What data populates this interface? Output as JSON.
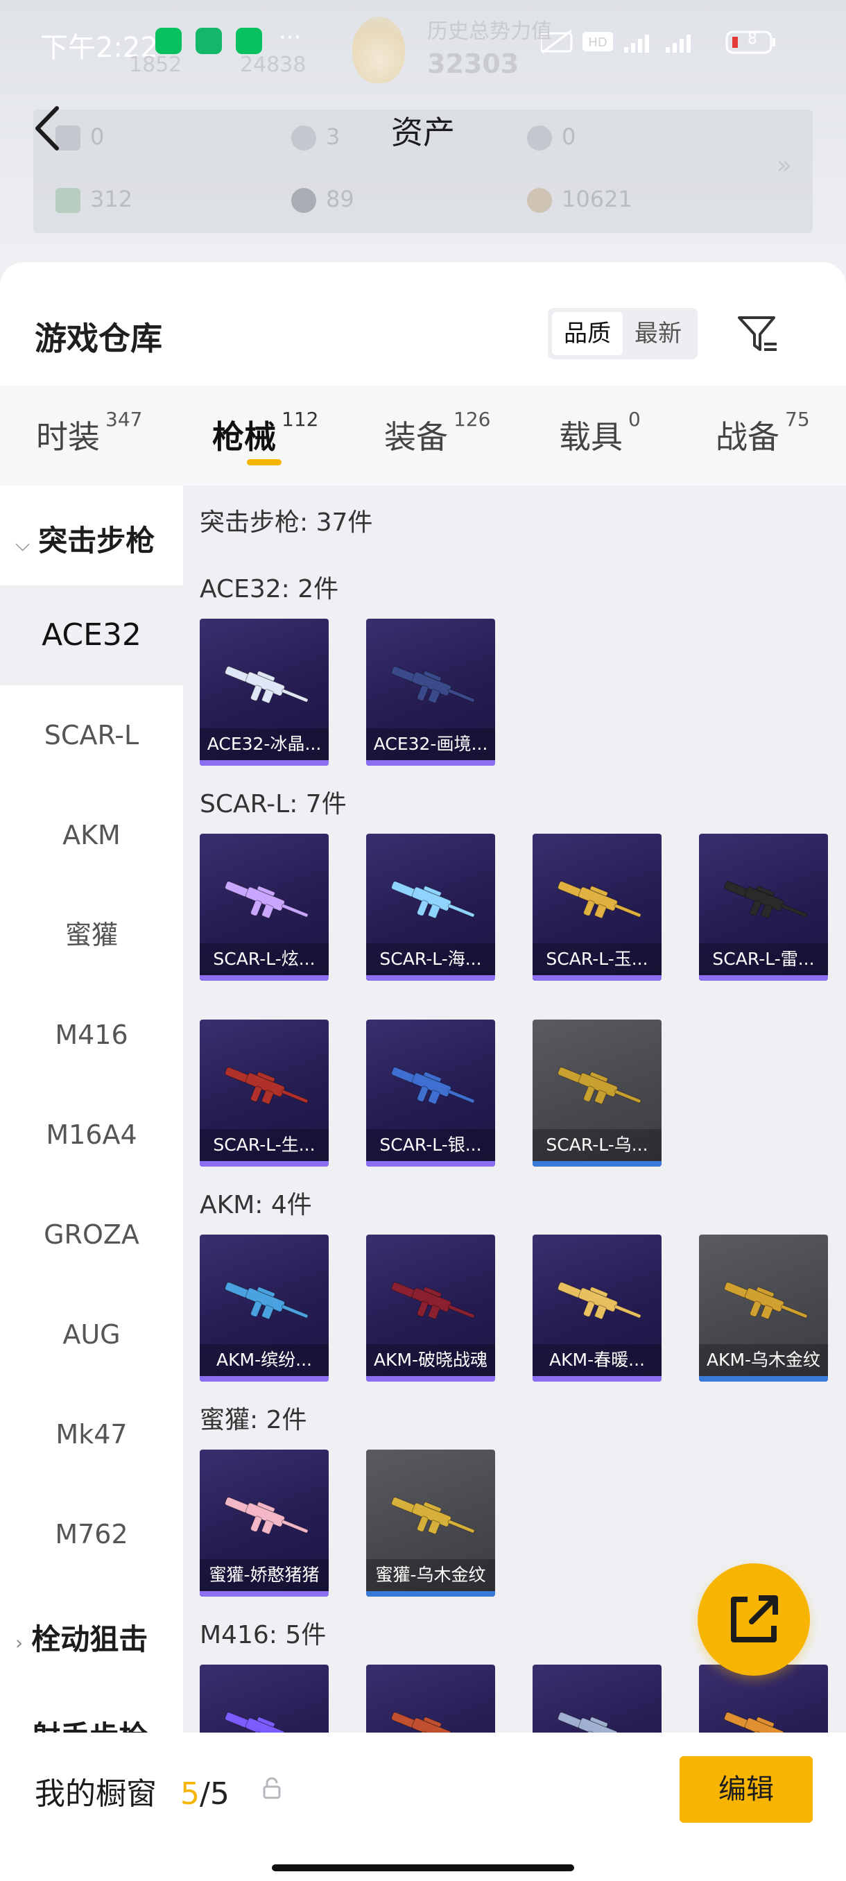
{
  "status_bar": {
    "time": "下午2:22",
    "dots": "···",
    "battery": "8"
  },
  "background_ghost": {
    "left_value": "1852",
    "middle_value": "24838",
    "history_label": "历史总势力值",
    "history_value": "32303"
  },
  "assets": {
    "title": "资产",
    "items": [
      {
        "icon": "card-icon",
        "value": "0"
      },
      {
        "icon": "coin-s-icon",
        "value": "3"
      },
      {
        "icon": "coin-a-icon",
        "value": "0"
      },
      {
        "icon": "ticket-icon",
        "value": "312"
      },
      {
        "icon": "ball-icon",
        "value": "89"
      },
      {
        "icon": "medal-icon",
        "value": "10621"
      }
    ],
    "more": "»"
  },
  "warehouse": {
    "title": "游戏仓库",
    "sort_quality": "品质",
    "sort_newest": "最新"
  },
  "tabs": [
    {
      "label": "时装",
      "count": "347"
    },
    {
      "label": "枪械",
      "count": "112"
    },
    {
      "label": "装备",
      "count": "126"
    },
    {
      "label": "载具",
      "count": "0"
    },
    {
      "label": "战备",
      "count": "75"
    }
  ],
  "sidebar": {
    "group_open": "突击步枪",
    "items": [
      "ACE32",
      "SCAR-L",
      "AKM",
      "蜜獾",
      "M416",
      "M16A4",
      "GROZA",
      "AUG",
      "Mk47",
      "M762"
    ],
    "group_closed": "栓动狙击",
    "group_cut": "射手步枪"
  },
  "main": {
    "category_total": "突击步枪: 37件",
    "sections": [
      {
        "title": "ACE32: 2件",
        "items": [
          "ACE32-冰晶...",
          "ACE32-画境..."
        ]
      },
      {
        "title": "SCAR-L: 7件",
        "items": [
          "SCAR-L-炫...",
          "SCAR-L-海...",
          "SCAR-L-玉...",
          "SCAR-L-雷...",
          "SCAR-L-生...",
          "SCAR-L-银...",
          "SCAR-L-乌..."
        ]
      },
      {
        "title": "AKM: 4件",
        "items": [
          "AKM-缤纷...",
          "AKM-破晓战魂",
          "AKM-春暖...",
          "AKM-乌木金纹"
        ]
      },
      {
        "title": "蜜獾: 2件",
        "items": [
          "蜜獾-娇憨猪猪",
          "蜜獾-乌木金纹"
        ]
      },
      {
        "title": "M416: 5件"
      }
    ]
  },
  "bottom": {
    "label": "我的橱窗",
    "count_current": "5",
    "count_total": "/5",
    "edit": "编辑"
  },
  "colors": {
    "accent": "#f7b400",
    "epic": "#8b6ff0",
    "rare": "#3a79d8"
  }
}
